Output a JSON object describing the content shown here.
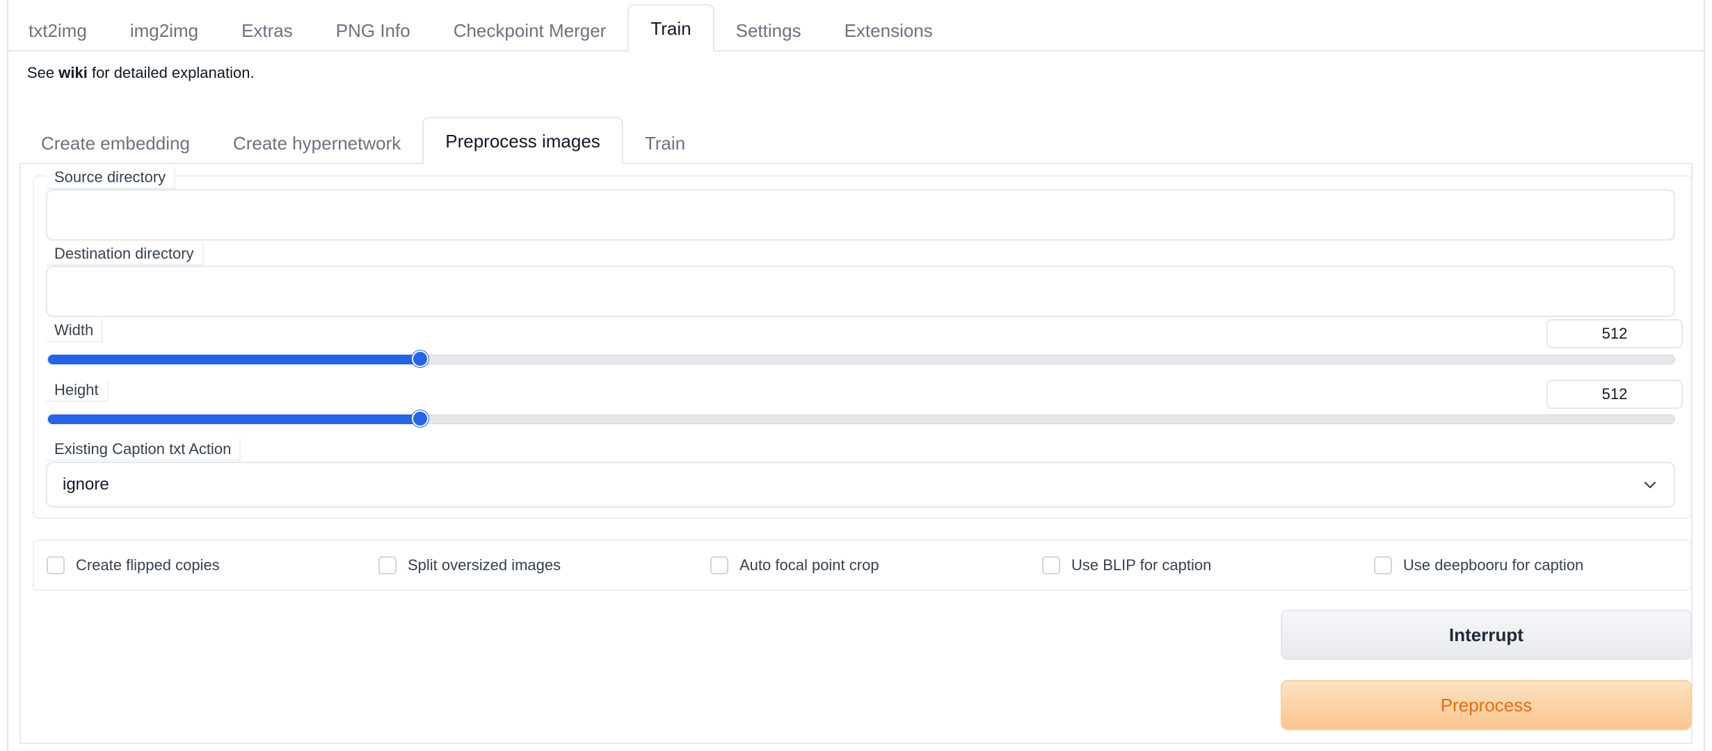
{
  "top_tabs": [
    "txt2img",
    "img2img",
    "Extras",
    "PNG Info",
    "Checkpoint Merger",
    "Train",
    "Settings",
    "Extensions"
  ],
  "top_tabs_active": "Train",
  "wiki": {
    "prefix": "See ",
    "link": "wiki",
    "suffix": " for detailed explanation."
  },
  "sub_tabs": [
    "Create embedding",
    "Create hypernetwork",
    "Preprocess images",
    "Train"
  ],
  "sub_tabs_active": "Preprocess images",
  "form": {
    "source_label": "Source directory",
    "source_value": "",
    "dest_label": "Destination directory",
    "dest_value": "",
    "width_label": "Width",
    "width_value": "512",
    "width_fraction": 0.229,
    "height_label": "Height",
    "height_value": "512",
    "height_fraction": 0.229,
    "caption_action_label": "Existing Caption txt Action",
    "caption_action_value": "ignore"
  },
  "checkboxes": [
    "Create flipped copies",
    "Split oversized images",
    "Auto focal point crop",
    "Use BLIP for caption",
    "Use deepbooru for caption"
  ],
  "buttons": {
    "interrupt": "Interrupt",
    "preprocess": "Preprocess"
  },
  "colors": {
    "accent": "#2563eb",
    "primary_text": "#ea6c0c",
    "primary_bg": "#f9c58c"
  }
}
